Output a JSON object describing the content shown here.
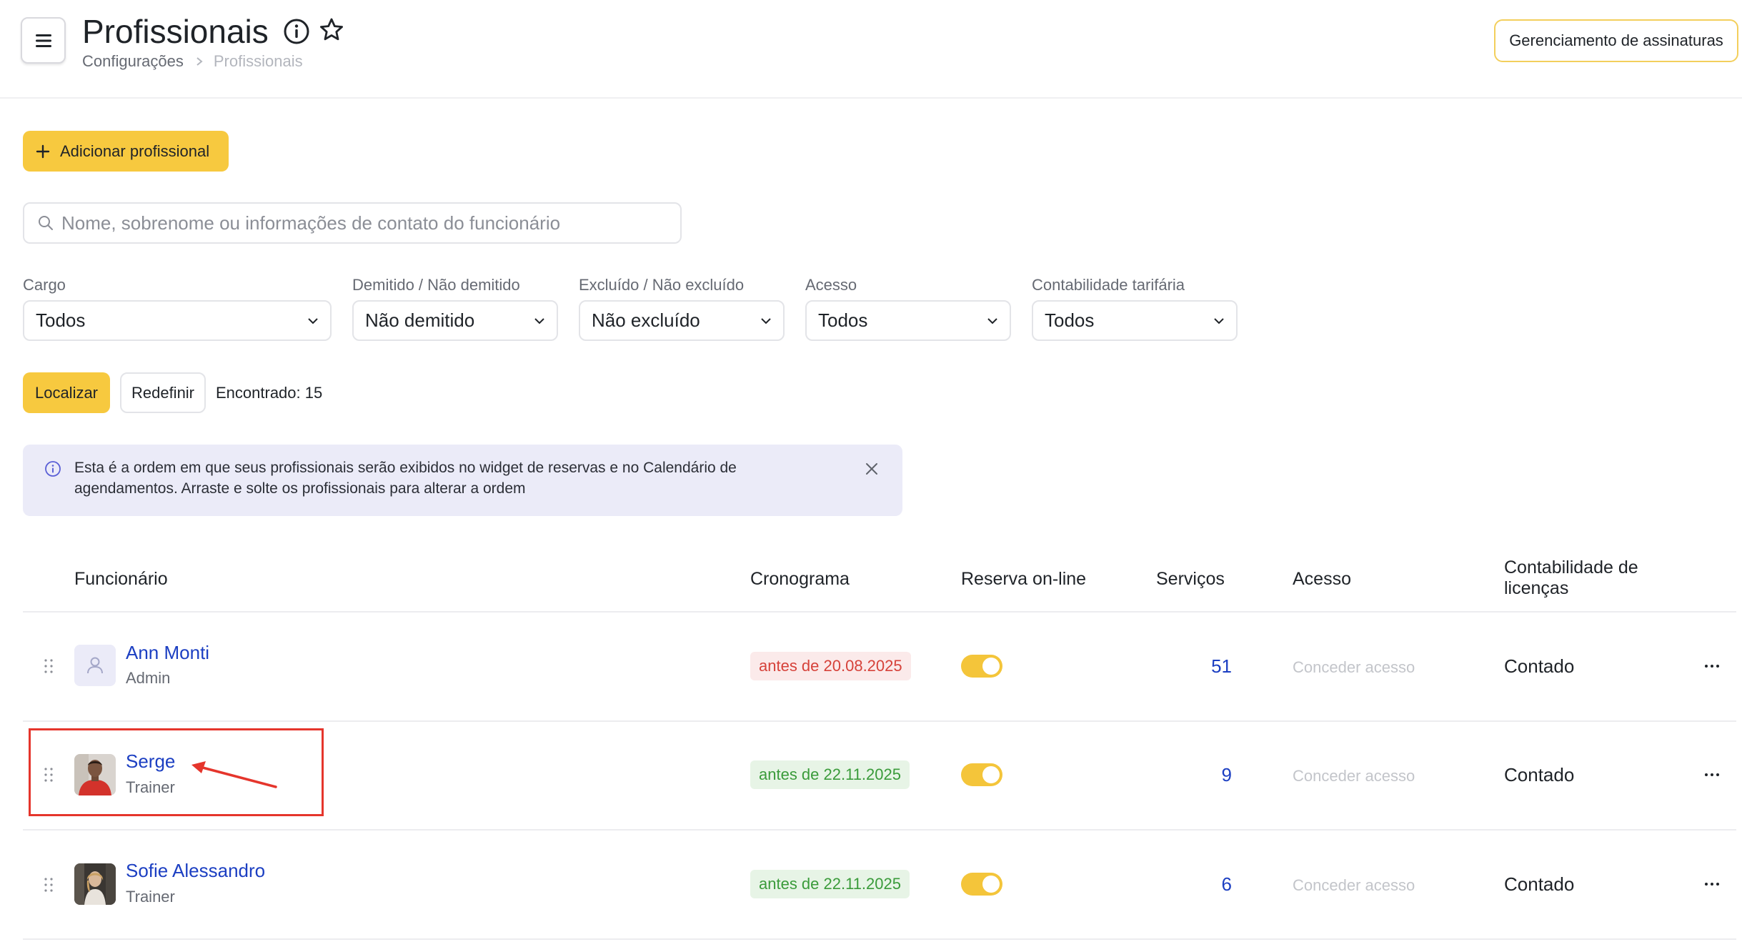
{
  "header": {
    "title": "Profissionais",
    "breadcrumb": [
      "Configurações",
      "Profissionais"
    ],
    "subscriptions_button": "Gerenciamento de assinaturas"
  },
  "toolbar": {
    "add_button": "Adicionar profissional",
    "search_placeholder": "Nome, sobrenome ou informações de contato do funcionário"
  },
  "filters": [
    {
      "label": "Cargo",
      "value": "Todos"
    },
    {
      "label": "Demitido / Não demitido",
      "value": "Não demitido"
    },
    {
      "label": "Excluído / Não excluído",
      "value": "Não excluído"
    },
    {
      "label": "Acesso",
      "value": "Todos"
    },
    {
      "label": "Contabilidade tarifária",
      "value": "Todos"
    }
  ],
  "actions": {
    "find_button": "Localizar",
    "reset_button": "Redefinir",
    "found_text": "Encontrado: 15"
  },
  "banner": {
    "text": "Esta é a ordem em que seus profissionais serão exibidos no widget de reservas e no Calendário de agendamentos. Arraste e solte os profissionais para alterar a ordem"
  },
  "table": {
    "headers": {
      "employee": "Funcionário",
      "schedule": "Cronograma",
      "online_booking": "Reserva on-line",
      "services": "Serviços",
      "access": "Acesso",
      "license": "Contabilidade de licenças"
    },
    "rows": [
      {
        "name": "Ann Monti",
        "role": "Admin",
        "schedule": "antes de 20.08.2025",
        "schedule_status": "expired",
        "online_booking": true,
        "services": "51",
        "access": "Conceder acesso",
        "license": "Contado"
      },
      {
        "name": "Serge",
        "role": "Trainer",
        "schedule": "antes de 22.11.2025",
        "schedule_status": "active",
        "online_booking": true,
        "services": "9",
        "access": "Conceder acesso",
        "license": "Contado"
      },
      {
        "name": "Sofie Alessandro",
        "role": "Trainer",
        "schedule": "antes de 22.11.2025",
        "schedule_status": "active",
        "online_booking": true,
        "services": "6",
        "access": "Conceder acesso",
        "license": "Contado"
      }
    ]
  },
  "colors": {
    "accent": "#f7c93f",
    "link": "#1c3fc2",
    "expired_text": "#d6423a",
    "active_text": "#3a9b3a",
    "banner_bg": "#ebebf8",
    "annotation": "#e5352c"
  }
}
